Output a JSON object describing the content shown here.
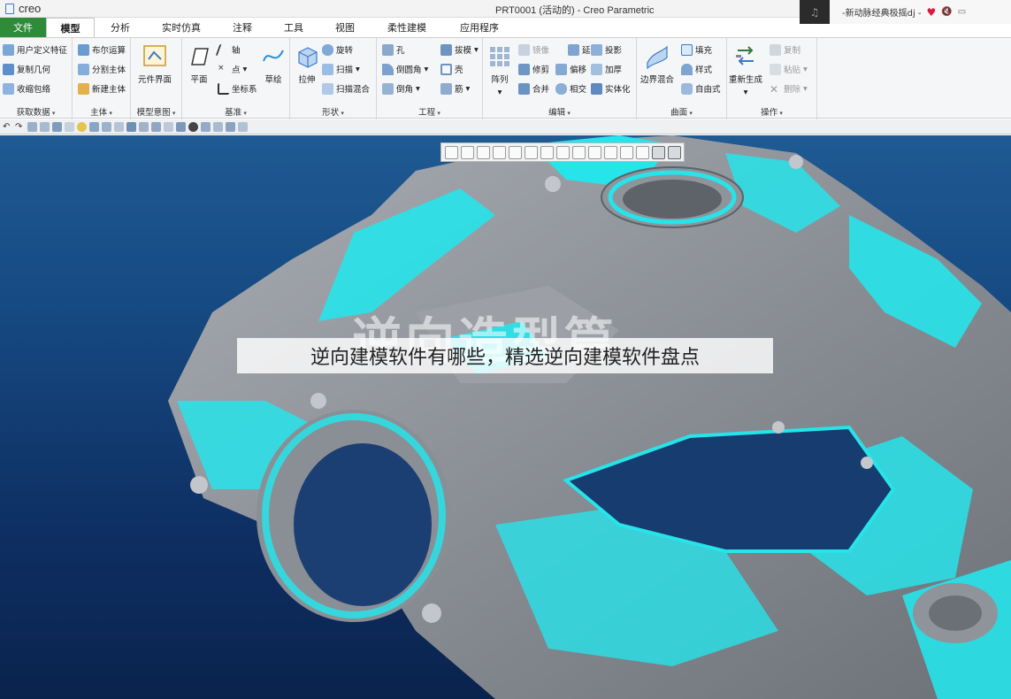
{
  "app": {
    "logo_text": "creo",
    "window_title": "PRT0001 (活动的) - Creo Parametric"
  },
  "music": {
    "title": "-新动脉经典极摇dj -"
  },
  "menu": {
    "file": "文件",
    "tabs": [
      "模型",
      "分析",
      "实时仿真",
      "注释",
      "工具",
      "视图",
      "柔性建模",
      "应用程序"
    ]
  },
  "ribbon": {
    "get_data": {
      "label": "获取数据",
      "items": [
        "用户定义特征",
        "复制几何",
        "收缩包络"
      ]
    },
    "body": {
      "label": "主体",
      "items": [
        "布尔运算",
        "分割主体",
        "新建主体"
      ]
    },
    "model_intent": {
      "label": "模型意图",
      "big": "元件界面"
    },
    "datum": {
      "label": "基准",
      "big_plane": "平面",
      "big_sketch": "草绘",
      "items": [
        "轴",
        "点",
        "坐标系"
      ]
    },
    "shapes": {
      "label": "形状",
      "big": "拉伸",
      "items": [
        "旋转",
        "扫描",
        "扫描混合"
      ]
    },
    "engineering": {
      "label": "工程",
      "items": [
        "孔",
        "倒圆角",
        "倒角",
        "拔模",
        "壳",
        "筋"
      ]
    },
    "editing": {
      "label": "编辑",
      "big": "阵列",
      "items": [
        "镜像",
        "延伸",
        "投影",
        "修剪",
        "偏移",
        "加厚",
        "合并",
        "相交",
        "实体化"
      ]
    },
    "surfaces": {
      "label": "曲面",
      "big": "边界混合",
      "items": [
        "填充",
        "样式",
        "自由式"
      ]
    },
    "operations": {
      "label": "操作",
      "big": "重新生成",
      "items": [
        "复制",
        "粘贴",
        "删除"
      ]
    }
  },
  "viewport": {
    "watermark": "逆向造型篇",
    "caption": "逆向建模软件有哪些，精选逆向建模软件盘点"
  },
  "colors": {
    "file_tab": "#2e8b3a",
    "model_cyan": "#27e3ea",
    "model_gray": "#8e9298",
    "bg_top": "#1f5a93",
    "bg_bottom": "#0a234d"
  }
}
